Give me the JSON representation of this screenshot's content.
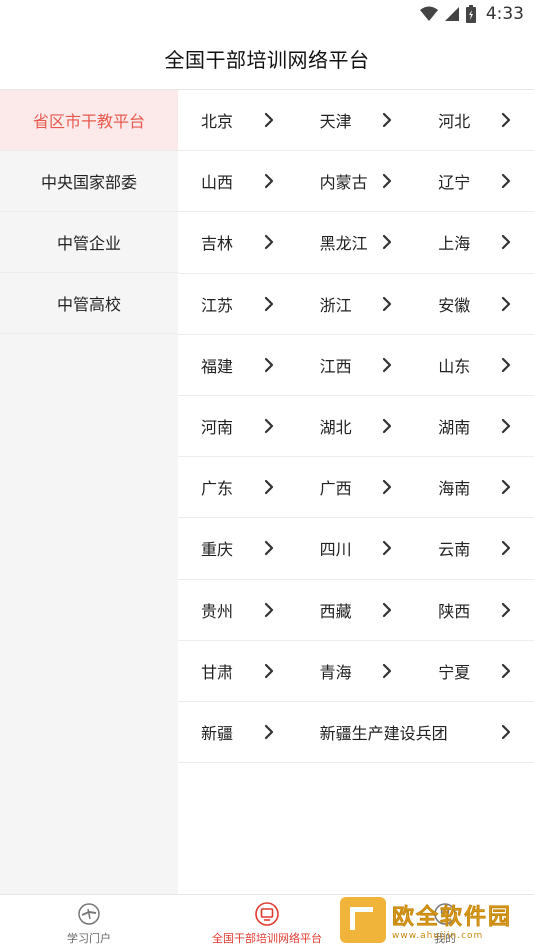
{
  "status": {
    "time": "4:33"
  },
  "header": {
    "title": "全国干部培训网络平台"
  },
  "sidebar": {
    "items": [
      {
        "label": "省区市干教平台",
        "active": true
      },
      {
        "label": "中央国家部委",
        "active": false
      },
      {
        "label": "中管企业",
        "active": false
      },
      {
        "label": "中管高校",
        "active": false
      }
    ]
  },
  "regions": {
    "rows": [
      [
        "北京",
        "天津",
        "河北"
      ],
      [
        "山西",
        "内蒙古",
        "辽宁"
      ],
      [
        "吉林",
        "黑龙江",
        "上海"
      ],
      [
        "江苏",
        "浙江",
        "安徽"
      ],
      [
        "福建",
        "江西",
        "山东"
      ],
      [
        "河南",
        "湖北",
        "湖南"
      ],
      [
        "广东",
        "广西",
        "海南"
      ],
      [
        "重庆",
        "四川",
        "云南"
      ],
      [
        "贵州",
        "西藏",
        "陕西"
      ],
      [
        "甘肃",
        "青海",
        "宁夏"
      ],
      [
        "新疆",
        "新疆生产建设兵团"
      ]
    ]
  },
  "tabbar": {
    "tabs": [
      {
        "label": "学习门户",
        "icon": "portal-icon",
        "active": false
      },
      {
        "label": "全国干部培训网络平台",
        "icon": "monitor-icon",
        "active": true
      },
      {
        "label": "我的",
        "icon": "user-icon",
        "active": false
      }
    ]
  },
  "watermark": {
    "title": "欧全软件园",
    "url": "www.ahuijin.com"
  },
  "colors": {
    "accent": "#e85a4f",
    "active_bg": "#fce9e9",
    "tab_active": "#e03b31"
  }
}
